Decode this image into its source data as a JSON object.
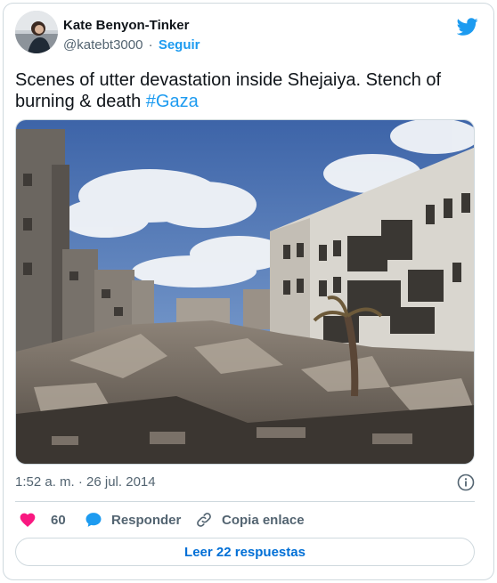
{
  "author": {
    "name": "Kate Benyon-Tinker",
    "handle": "@katebt3000",
    "separator": "·",
    "follow_label": "Seguir"
  },
  "tweet": {
    "text": "Scenes of utter devastation inside Shejaiya. Stench of burning & death ",
    "hashtag": "#Gaza",
    "timestamp": "1:52 a. m. · 26 jul. 2014"
  },
  "actions": {
    "like_count": "60",
    "reply_label": "Responder",
    "copy_label": "Copia enlace"
  },
  "read_replies_label": "Leer 22 respuestas",
  "icons": {
    "brand": "twitter-bird-icon",
    "info": "info-icon",
    "like": "heart-icon",
    "reply": "speech-bubble-icon",
    "copy": "link-icon"
  },
  "colors": {
    "accent": "#1d9bf0",
    "like": "#f91880",
    "text": "#0f1419",
    "secondary": "#536471",
    "border": "#cfd9de",
    "replies_text": "#006fd6"
  }
}
